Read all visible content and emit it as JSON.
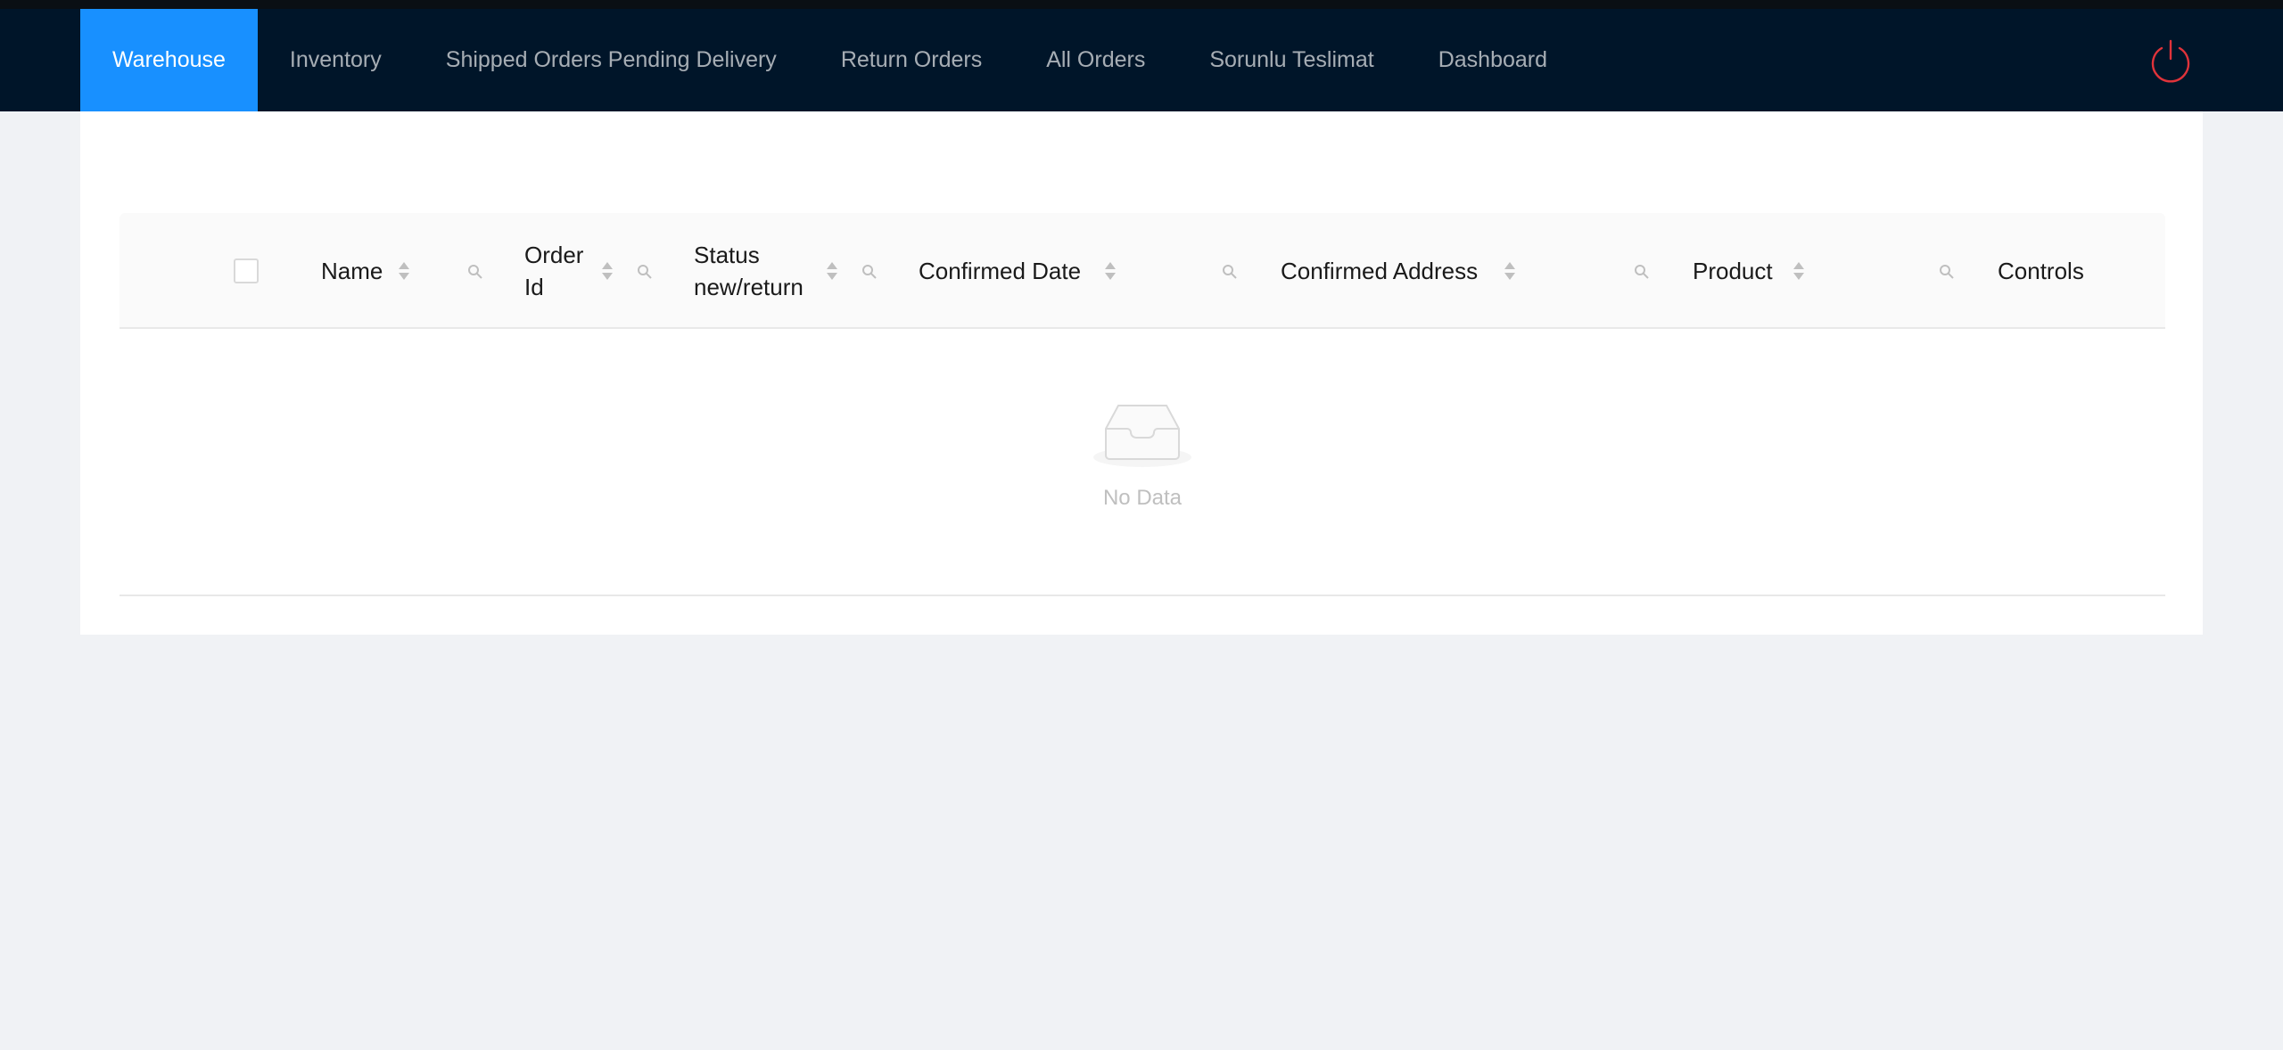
{
  "nav": {
    "items": [
      {
        "label": "Warehouse",
        "active": true
      },
      {
        "label": "Inventory"
      },
      {
        "label": "Shipped Orders Pending Delivery"
      },
      {
        "label": "Return Orders"
      },
      {
        "label": "All Orders"
      },
      {
        "label": "Sorunlu Teslimat"
      },
      {
        "label": "Dashboard"
      }
    ],
    "power_icon": "power-icon"
  },
  "table": {
    "columns": [
      {
        "label": "Name"
      },
      {
        "label_line1": "Order",
        "label_line2": "Id"
      },
      {
        "label_line1": "Status",
        "label_line2": "new/return"
      },
      {
        "label": "Confirmed Date"
      },
      {
        "label": "Confirmed Address"
      },
      {
        "label": "Product"
      },
      {
        "label": "Controls"
      }
    ],
    "empty_text": "No Data"
  },
  "colors": {
    "header_bg": "#001529",
    "active_tab": "#1890ff",
    "power_icon": "#e0333a"
  }
}
